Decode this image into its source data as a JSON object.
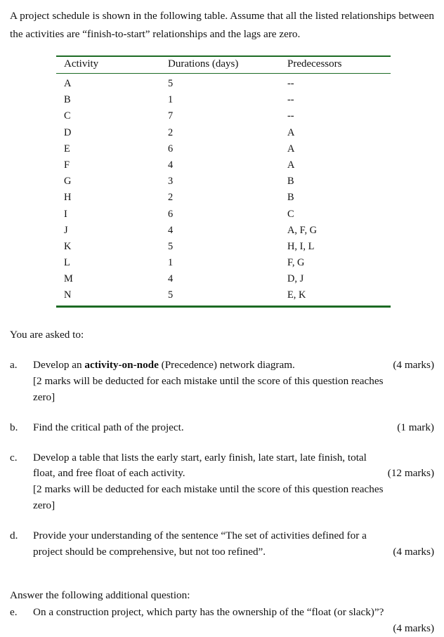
{
  "intro": {
    "paragraph": "A project schedule is shown in the following table. Assume that all the listed relationships between the activities are “finish-to-start” relationships and the lags are zero."
  },
  "theme": {
    "rule_color": "#1c6b24",
    "text_color": "#111111",
    "background": "#ffffff"
  },
  "table": {
    "headers": [
      "Activity",
      "Durations (days)",
      "Predecessors"
    ],
    "rows": [
      {
        "activity": "A",
        "duration": "5",
        "predecessors": "--"
      },
      {
        "activity": "B",
        "duration": "1",
        "predecessors": "--"
      },
      {
        "activity": "C",
        "duration": "7",
        "predecessors": "--"
      },
      {
        "activity": "D",
        "duration": "2",
        "predecessors": "A"
      },
      {
        "activity": "E",
        "duration": "6",
        "predecessors": "A"
      },
      {
        "activity": "F",
        "duration": "4",
        "predecessors": "A"
      },
      {
        "activity": "G",
        "duration": "3",
        "predecessors": "B"
      },
      {
        "activity": "H",
        "duration": "2",
        "predecessors": "B"
      },
      {
        "activity": "I",
        "duration": "6",
        "predecessors": "C"
      },
      {
        "activity": "J",
        "duration": "4",
        "predecessors": "A, F, G"
      },
      {
        "activity": "K",
        "duration": "5",
        "predecessors": "H, I, L"
      },
      {
        "activity": "L",
        "duration": "1",
        "predecessors": "F, G"
      },
      {
        "activity": "M",
        "duration": "4",
        "predecessors": "D, J"
      },
      {
        "activity": "N",
        "duration": "5",
        "predecessors": "E, K"
      }
    ]
  },
  "asked": {
    "lead_in": "You are asked to:",
    "items": [
      {
        "marker": "a.",
        "text_before_bold": "Develop an ",
        "bold": "activity-on-node",
        "text_after_bold": " (Precedence) network diagram.",
        "marks": "(4 marks)",
        "note": "[2 marks will be deducted for each mistake until the score of this question reaches",
        "note_tail": "zero]"
      },
      {
        "marker": "b.",
        "text": "Find the critical path of the project.",
        "marks": "(1 mark)"
      },
      {
        "marker": "c.",
        "line1": "Develop a table that lists the early start, early finish, late start, late finish, total",
        "line2": "float, and free float of each activity.",
        "marks": "(12 marks)",
        "note": "[2 marks will be deducted for each mistake until the score of this question reaches",
        "note_tail": "zero]"
      },
      {
        "marker": "d.",
        "line1": "Provide your understanding of the sentence “The set of activities defined for a",
        "line2": "project should be comprehensive, but not too refined”.",
        "marks": "(4 marks)"
      }
    ]
  },
  "additional": {
    "lead_in": "Answer the following additional question:",
    "item": {
      "marker": "e.",
      "text": "On a construction project, which party has the ownership of the “float (or slack)”?",
      "marks": "(4 marks)"
    }
  }
}
